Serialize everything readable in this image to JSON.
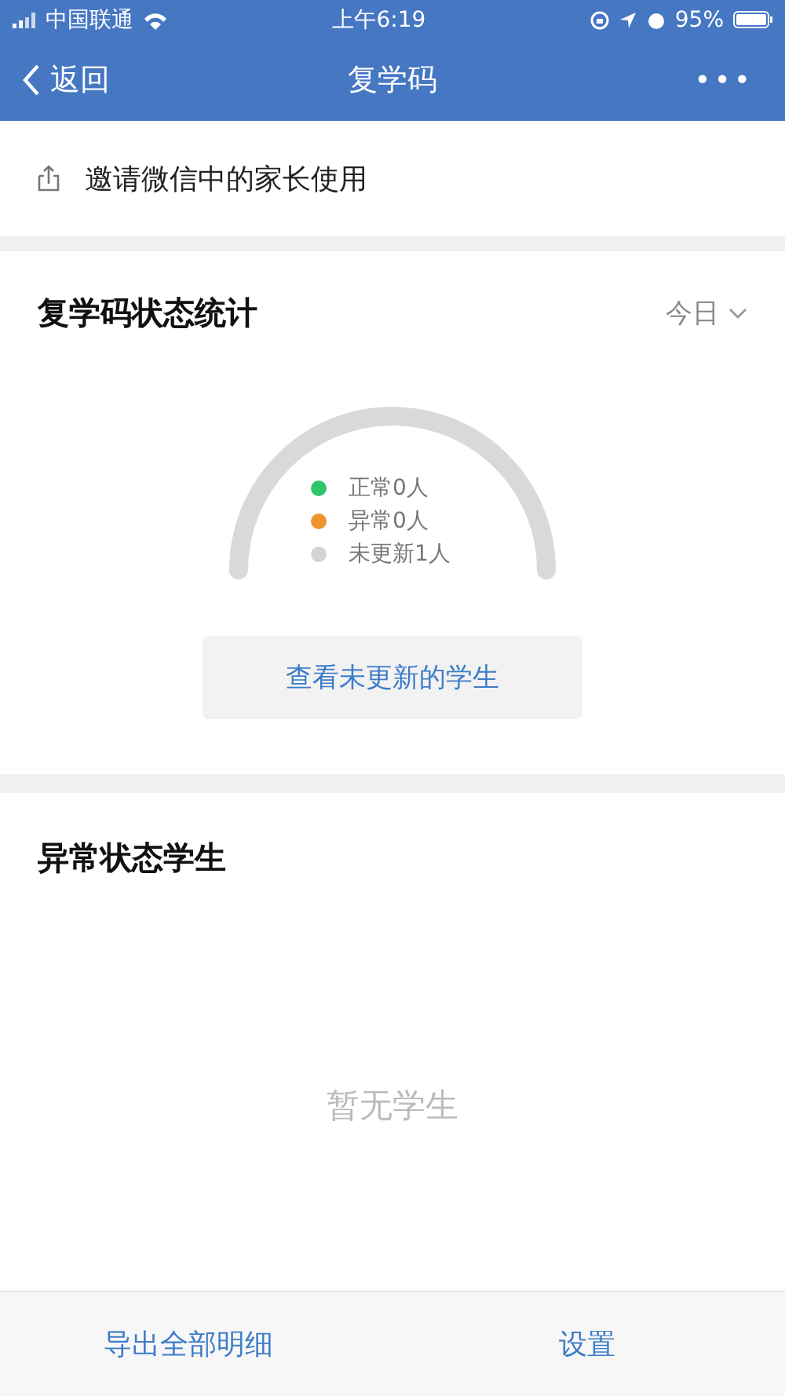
{
  "status_bar": {
    "carrier": "中国联通",
    "time": "上午6:19",
    "battery": "95%"
  },
  "nav_bar": {
    "back": "返回",
    "title": "复学码",
    "more": "•••"
  },
  "invite": {
    "label": "邀请微信中的家长使用"
  },
  "stats": {
    "title": "复学码状态统计",
    "period": "今日",
    "legend": [
      {
        "label": "正常0人",
        "color": "#2dc66a"
      },
      {
        "label": "异常0人",
        "color": "#f0932b"
      },
      {
        "label": "未更新1人",
        "color": "#d4d4d4"
      }
    ],
    "button": "查看未更新的学生"
  },
  "abnormal": {
    "title": "异常状态学生",
    "empty": "暂无学生"
  },
  "bottom_bar": [
    "导出全部明细",
    "设置"
  ]
}
